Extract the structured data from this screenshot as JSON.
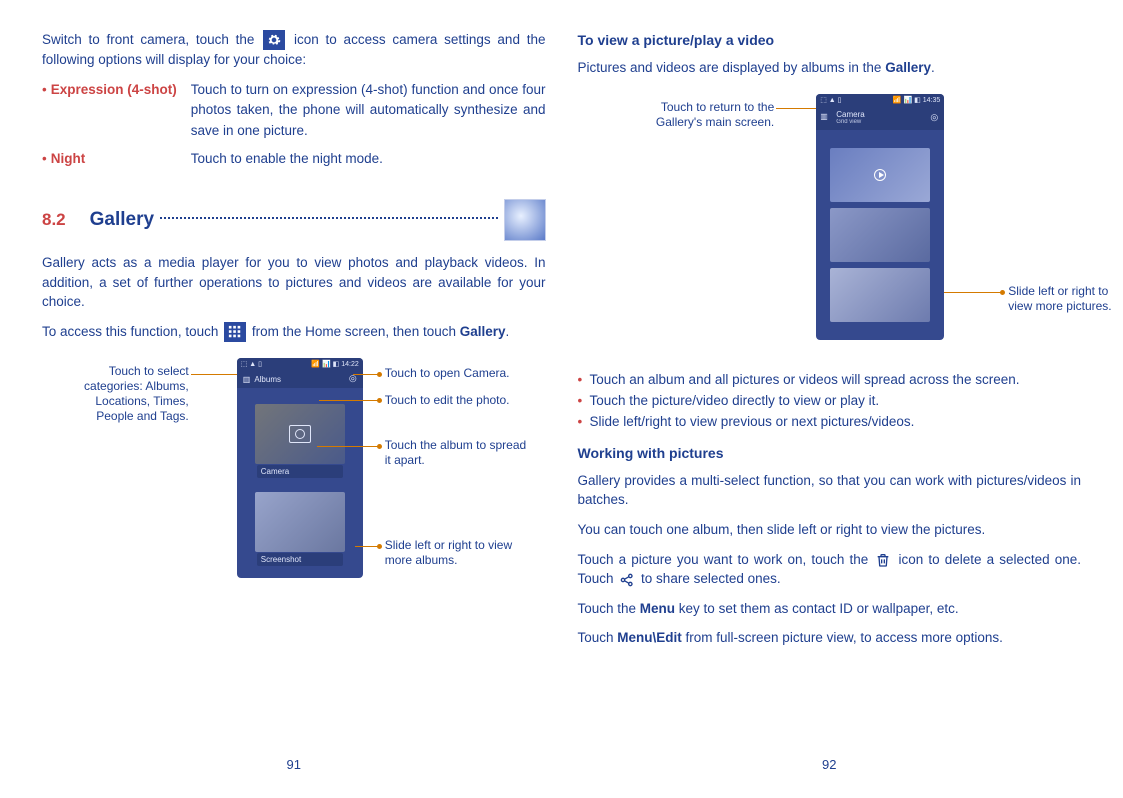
{
  "left": {
    "intro_a": "Switch to front camera, touch the ",
    "intro_b": " icon to access camera settings and the following options will display for your choice:",
    "features": [
      {
        "name": "Expression (4-shot)",
        "desc": "Touch to turn on expression (4-shot) function and once four photos taken, the phone will automatically synthesize and save in one picture."
      },
      {
        "name": "Night",
        "desc": "Touch to enable the night mode."
      }
    ],
    "sec_num": "8.2",
    "sec_title": "Gallery",
    "gallery_para": "Gallery acts as a media player for you to view photos and playback videos. In addition, a set of further operations to pictures and videos are available for your choice.",
    "access_a": "To access this function, touch ",
    "access_b": " from the Home screen, then touch ",
    "access_gallery": "Gallery",
    "access_c": ".",
    "fig1": {
      "phone_time": "14:22",
      "phone_signal": "⬚ ▲ ▯",
      "phone_signal_r": "📶 📊 ◧",
      "topbar_label": "Albums",
      "album1_label": "Camera",
      "album2_label": "Screenshot",
      "c_select": "Touch to select categories: Albums, Locations, Times, People and Tags.",
      "c_open_cam": "Touch to open Camera.",
      "c_edit": "Touch to edit the photo.",
      "c_spread": "Touch the album to spread it apart.",
      "c_slide": "Slide left or right to view more albums."
    },
    "page_num": "91"
  },
  "right": {
    "h1": "To view a picture/play a video",
    "intro_a": "Pictures and videos are displayed by albums in the ",
    "intro_gal": "Gallery",
    "intro_b": ".",
    "fig2": {
      "phone_time": "14:35",
      "topbar_label1": "Camera",
      "topbar_label2": "Grid view",
      "c_return": "Touch to return to the Gallery's main screen.",
      "c_slide": "Slide left or right to view more pictures."
    },
    "bullets": [
      "Touch an album and all pictures or videos will spread across the screen.",
      "Touch the picture/video directly to view or play it.",
      "Slide left/right to view previous or next pictures/videos."
    ],
    "h2": "Working with pictures",
    "p1": "Gallery provides a multi-select function, so that you can work with pictures/videos in batches.",
    "p2": "You can touch one album, then slide left or right to view the pictures.",
    "p3_a": "Touch a picture you want to work on, touch the ",
    "p3_b": " icon to delete a selected one. Touch ",
    "p3_c": " to share selected ones.",
    "p4_a": "Touch the ",
    "p4_menu": "Menu",
    "p4_b": " key to set them as contact ID or wallpaper, etc.",
    "p5_a": "Touch ",
    "p5_menu": "Menu\\Edit",
    "p5_b": " from full-screen picture view, to access more options.",
    "page_num": "92"
  },
  "icons": {
    "settings": "settings-icon",
    "apps_grid": "apps-grid-icon",
    "trash": "trash-icon",
    "share": "share-icon"
  }
}
